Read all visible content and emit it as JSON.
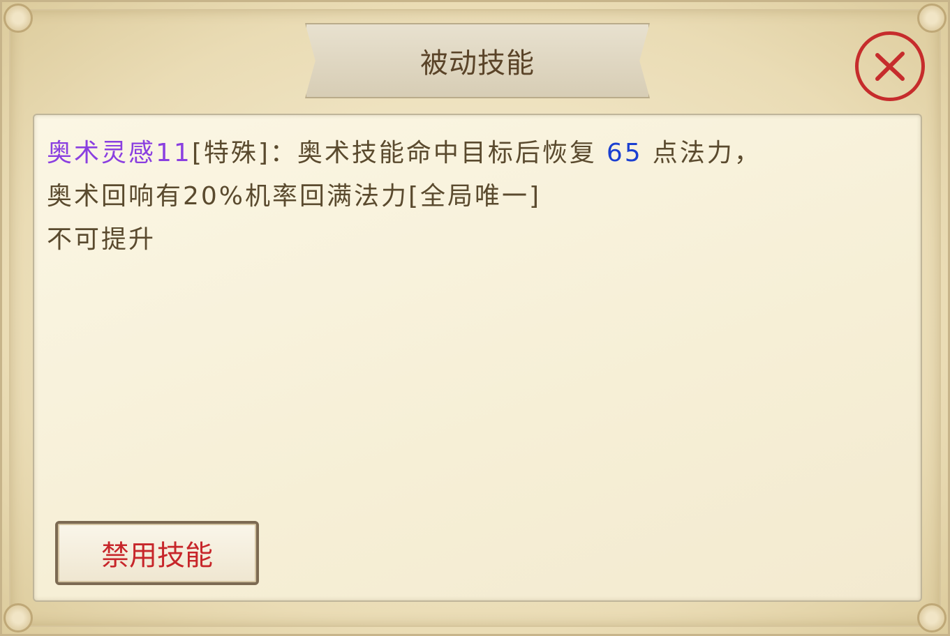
{
  "dialog": {
    "title": "被动技能",
    "close_icon": "close-icon"
  },
  "skill": {
    "name": "奥术灵感11",
    "line1_after_name": "[特殊]：奥术技能命中目标后恢复",
    "restore_amount": "65",
    "line1_tail": "点法力，",
    "line2": "奥术回响有20%机率回满法力[全局唯一]",
    "upgrade_status": "不可提升"
  },
  "actions": {
    "disable_label": "禁用技能"
  },
  "colors": {
    "skill_name": "#8a3fe0",
    "restore_amount": "#1a3fd1",
    "body_text": "#5a4a2e",
    "disable_label": "#c7262a",
    "close_accent": "#c62c2c"
  }
}
